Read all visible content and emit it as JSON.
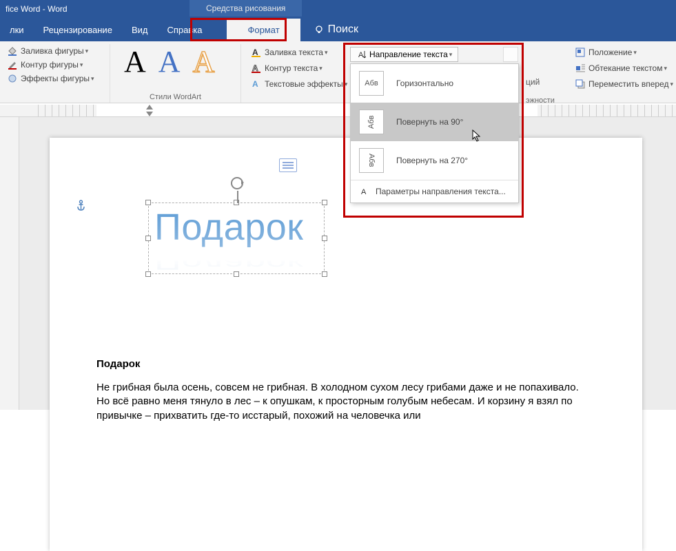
{
  "titlebar": {
    "app": "fice Word  -  Word",
    "context_tab": "Средства рисования"
  },
  "menu": {
    "items": [
      "лки",
      "Рецензирование",
      "Вид",
      "Справка"
    ],
    "format": "Формат",
    "search": "Поиск"
  },
  "ribbon": {
    "shape_fill": "Заливка фигуры",
    "shape_outline": "Контур фигуры",
    "shape_effects": "Эффекты фигуры",
    "wordart_group": "Стили WordArt",
    "wa_sample": "A",
    "text_fill": "Заливка текста",
    "text_outline": "Контур текста",
    "text_effects": "Текстовые эффекты",
    "direction_btn": "Направление текста",
    "position": "Положение",
    "wrap": "Обтекание текстом",
    "forward": "Переместить вперед",
    "extra1": "ций",
    "extra2": "эжности"
  },
  "dropdown": {
    "sample": "Абв",
    "horiz": "Горизонтально",
    "rot90": "Повернуть на 90°",
    "rot270": "Повернуть на 270°",
    "params": "Параметры направления текста..."
  },
  "document": {
    "wordart": "Подарок",
    "heading": "Подарок",
    "body": "Не грибная была осень, совсем не грибная. В холодном сухом лесу грибами даже и не попахивало. Но всё равно меня тянуло в лес – к опушкам, к просторным голубым небесам. И корзину я взял по привычке – прихватить где-то исстарый, похожий на человечка или"
  }
}
